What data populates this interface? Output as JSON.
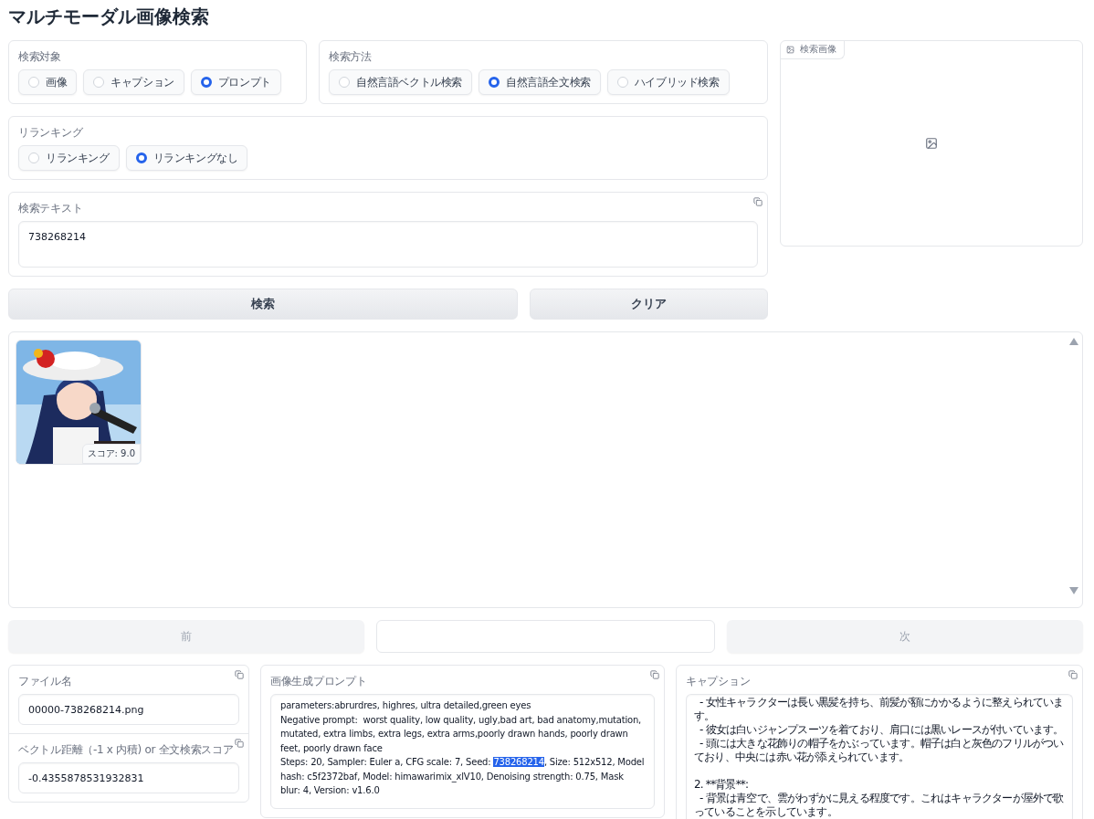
{
  "title": "マルチモーダル画像検索",
  "target": {
    "label": "検索対象",
    "options": [
      {
        "label": "画像",
        "selected": false
      },
      {
        "label": "キャプション",
        "selected": false
      },
      {
        "label": "プロンプト",
        "selected": true
      }
    ]
  },
  "method": {
    "label": "検索方法",
    "options": [
      {
        "label": "自然言語ベクトル検索",
        "selected": false
      },
      {
        "label": "自然言語全文検索",
        "selected": true
      },
      {
        "label": "ハイブリッド検索",
        "selected": false
      }
    ]
  },
  "rerank": {
    "label": "リランキング",
    "options": [
      {
        "label": "リランキング",
        "selected": false
      },
      {
        "label": "リランキングなし",
        "selected": true
      }
    ]
  },
  "search_text": {
    "label": "検索テキスト",
    "value": "738268214"
  },
  "image_input": {
    "label": "検索画像"
  },
  "actions": [
    {
      "label": "検索"
    },
    {
      "label": "クリア"
    }
  ],
  "gallery": {
    "items": [
      {
        "kind": "picture",
        "score": "スコア: 9.0"
      }
    ]
  },
  "nav": {
    "prev": {
      "label": "前",
      "disabled": true
    },
    "next": {
      "label": "次",
      "disabled": true
    }
  },
  "filename": {
    "label": "ファイル名",
    "value": "00000-738268214.png"
  },
  "distance": {
    "label": "ベクトル距離（-1 x 内積) or 全文検索スコア",
    "value": "-0.4355878531932831"
  },
  "prompt": {
    "label": "画像生成プロンプト",
    "segments": [
      {
        "text": "parameters:abrurdres, highres, ultra detailed,green eyes\nNegative prompt:  worst quality, low quality, ugly,bad art, bad anatomy,mutation, mutated, extra limbs, extra legs, extra arms,poorly drawn hands, poorly drawn feet, poorly drawn face\nSteps: 20, Sampler: Euler a, CFG scale: 7, Seed: ",
        "highlighted": false
      },
      {
        "text": "738268214",
        "highlighted": true
      },
      {
        "text": ", Size: 512x512, Model hash: c5f2372baf, Model: himawarimix_xlV10, Denoising strength: 0.75, Mask blur: 4, Version: v1.6.0",
        "highlighted": false
      }
    ]
  },
  "caption": {
    "label": "キャプション",
    "value": "  - 女性キャラクターは長い黒髪を持ち、前髪が額にかかるように整えられています。\n  - 彼女は白いジャンプスーツを着ており、肩口には黒いレースが付いています。\n  - 頭には大きな花飾りの帽子をかぶっています。帽子は白と灰色のフリルがついており、中央には赤い花が添えられています。\n\n2. **背景**:\n  - 背景は青空で、雲がわずかに見える程度です。これはキャラクターが屋外で歌っていることを示しています。"
  }
}
